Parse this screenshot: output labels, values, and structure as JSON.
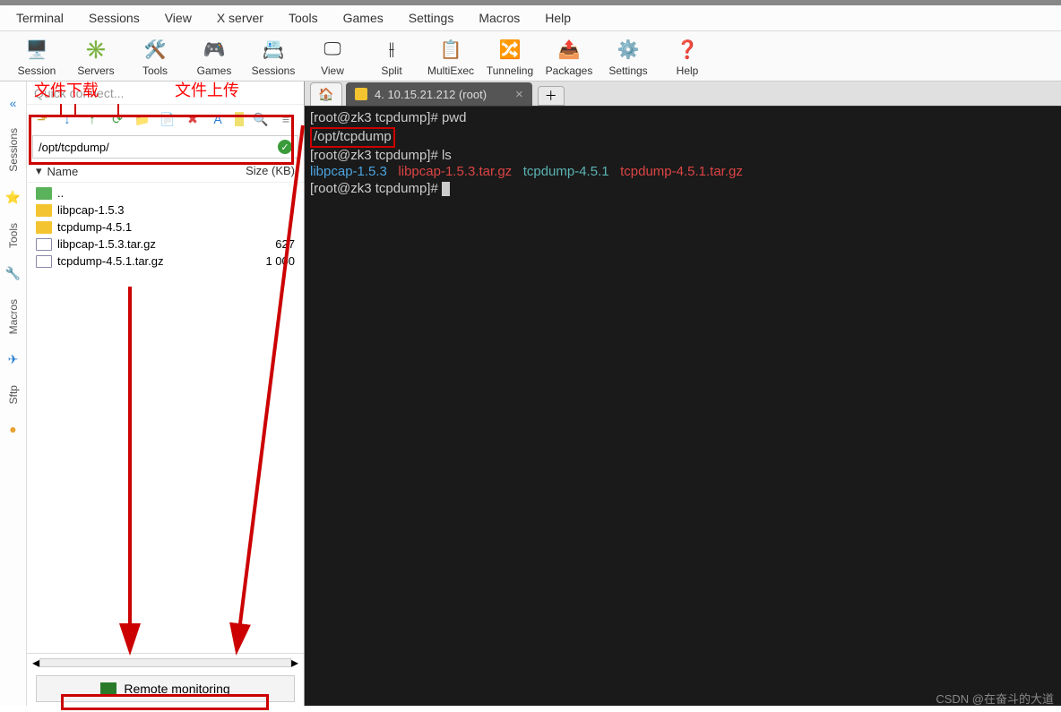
{
  "menubar": [
    "Terminal",
    "Sessions",
    "View",
    "X server",
    "Tools",
    "Games",
    "Settings",
    "Macros",
    "Help"
  ],
  "toolbar": [
    {
      "label": "Session",
      "icon": "🖥️"
    },
    {
      "label": "Servers",
      "icon": "✳️"
    },
    {
      "label": "Tools",
      "icon": "🛠️"
    },
    {
      "label": "Games",
      "icon": "🎮"
    },
    {
      "label": "Sessions",
      "icon": "📇"
    },
    {
      "label": "View",
      "icon": "🖵"
    },
    {
      "label": "Split",
      "icon": "⫲"
    },
    {
      "label": "MultiExec",
      "icon": "📋"
    },
    {
      "label": "Tunneling",
      "icon": "🔀"
    },
    {
      "label": "Packages",
      "icon": "📤"
    },
    {
      "label": "Settings",
      "icon": "⚙️"
    },
    {
      "label": "Help",
      "icon": "❓"
    }
  ],
  "annot": {
    "download": "文件下载",
    "upload": "文件上传"
  },
  "sidebar": {
    "quick_connect": "Quick connect...",
    "path": "/opt/tcpdump/",
    "headers": {
      "name": "Name",
      "size": "Size (KB)"
    },
    "files": [
      {
        "name": "..",
        "size": "",
        "type": "folder-green"
      },
      {
        "name": "libpcap-1.5.3",
        "size": "",
        "type": "folder"
      },
      {
        "name": "tcpdump-4.5.1",
        "size": "",
        "type": "folder"
      },
      {
        "name": "libpcap-1.5.3.tar.gz",
        "size": "627",
        "type": "file"
      },
      {
        "name": "tcpdump-4.5.1.tar.gz",
        "size": "1 000",
        "type": "file"
      }
    ],
    "remote_monitoring": "Remote monitoring"
  },
  "vtabs": [
    {
      "label": "Sessions",
      "icon": "⭐"
    },
    {
      "label": "Tools",
      "icon": "🔧"
    },
    {
      "label": "Macros",
      "icon": "✈"
    },
    {
      "label": "Sftp",
      "icon": "●"
    }
  ],
  "tab": {
    "title": "4. 10.15.21.212 (root)"
  },
  "terminal": {
    "l1_prompt": "[root@zk3 tcpdump]# ",
    "l1_cmd": "pwd",
    "l2": "/opt/tcpdump",
    "l3_prompt": "[root@zk3 tcpdump]# ",
    "l3_cmd": "ls",
    "l4_a": "libpcap-1.5.3",
    "l4_b": "libpcap-1.5.3.tar.gz",
    "l4_c": "tcpdump-4.5.1",
    "l4_d": "tcpdump-4.5.1.tar.gz",
    "l5_prompt": "[root@zk3 tcpdump]# "
  },
  "watermark": "CSDN @在奋斗的大道"
}
